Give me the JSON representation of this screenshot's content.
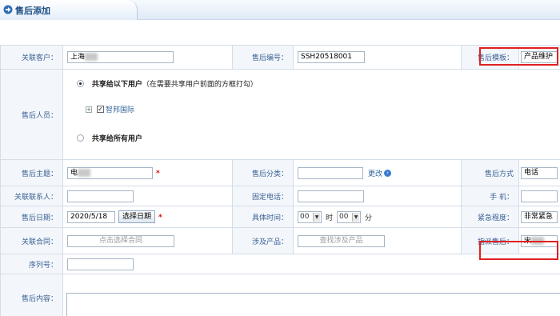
{
  "header": {
    "title": "售后添加"
  },
  "rows": {
    "customer": {
      "label": "关联客户：",
      "value": "上海"
    },
    "code": {
      "label": "售后编号：",
      "value": "SSH20518001"
    },
    "template": {
      "label": "售后模板：",
      "value": "产品维护"
    },
    "staff": {
      "label": "售后人员：",
      "share_some": "共享给以下用户",
      "share_some_note": "（在需要共享用户前面的方框打勾）",
      "tree_node": "智邦国际",
      "share_all": "共享给所有用户"
    },
    "subject": {
      "label": "售后主题：",
      "value": "电"
    },
    "category": {
      "label": "售后分类：",
      "value": "",
      "change_link": "更改"
    },
    "method": {
      "label": "售后方式",
      "value": "电话"
    },
    "contact": {
      "label": "关联联系人：",
      "value": ""
    },
    "phone": {
      "label": "固定电话：",
      "value": ""
    },
    "mobile": {
      "label": "手 机：",
      "value": ""
    },
    "date": {
      "label": "售后日期：",
      "value": "2020/5/18",
      "button": "选择日期"
    },
    "time": {
      "label": "具体时间：",
      "hour": "00",
      "hour_unit": "时",
      "minute": "00",
      "minute_unit": "分"
    },
    "urgency": {
      "label": "紧急程度：",
      "value": "非常紧急"
    },
    "contract": {
      "label": "关联合同：",
      "placeholder": "点击选择合同"
    },
    "product": {
      "label": "涉及产品：",
      "placeholder": "查找涉及产品"
    },
    "assignee": {
      "label": "指派售后：",
      "value": "宋"
    },
    "serial": {
      "label": "序列号：",
      "value": ""
    },
    "content": {
      "label": "售后内容："
    }
  },
  "colors": {
    "label_text": "#3a5f93",
    "label_bg": "#f3f7fb",
    "highlight": "#e02020",
    "required": "#e00000"
  }
}
